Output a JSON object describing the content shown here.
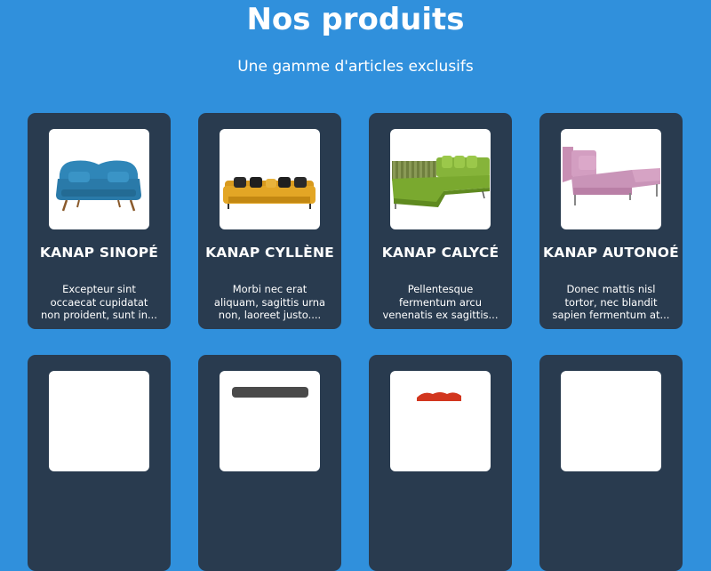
{
  "header": {
    "title": "Nos produits",
    "subtitle": "Une gamme d'articles exclusifs"
  },
  "colors": {
    "page_background": "#3090dc",
    "card_background": "#293b4f",
    "text": "#ffffff"
  },
  "products": [
    {
      "name": "KANAP SINOPÉ",
      "description": "Excepteur sint occaecat cupidatat non proident, sunt in...",
      "image": "blue-sofa-image"
    },
    {
      "name": "KANAP CYLLÈNE",
      "description": "Morbi nec erat aliquam, sagittis urna non, laoreet justo....",
      "image": "yellow-sofa-image"
    },
    {
      "name": "KANAP CALYCÉ",
      "description": "Pellentesque fermentum arcu venenatis ex sagittis...",
      "image": "green-sectional-image"
    },
    {
      "name": "KANAP AUTONOÉ",
      "description": "Donec mattis nisl tortor, nec blandit sapien fermentum at...",
      "image": "pink-sofa-image"
    },
    {
      "image": "product-image"
    },
    {
      "image": "grey-sofa-image"
    },
    {
      "image": "red-sofa-image"
    },
    {
      "image": "product-image"
    }
  ]
}
